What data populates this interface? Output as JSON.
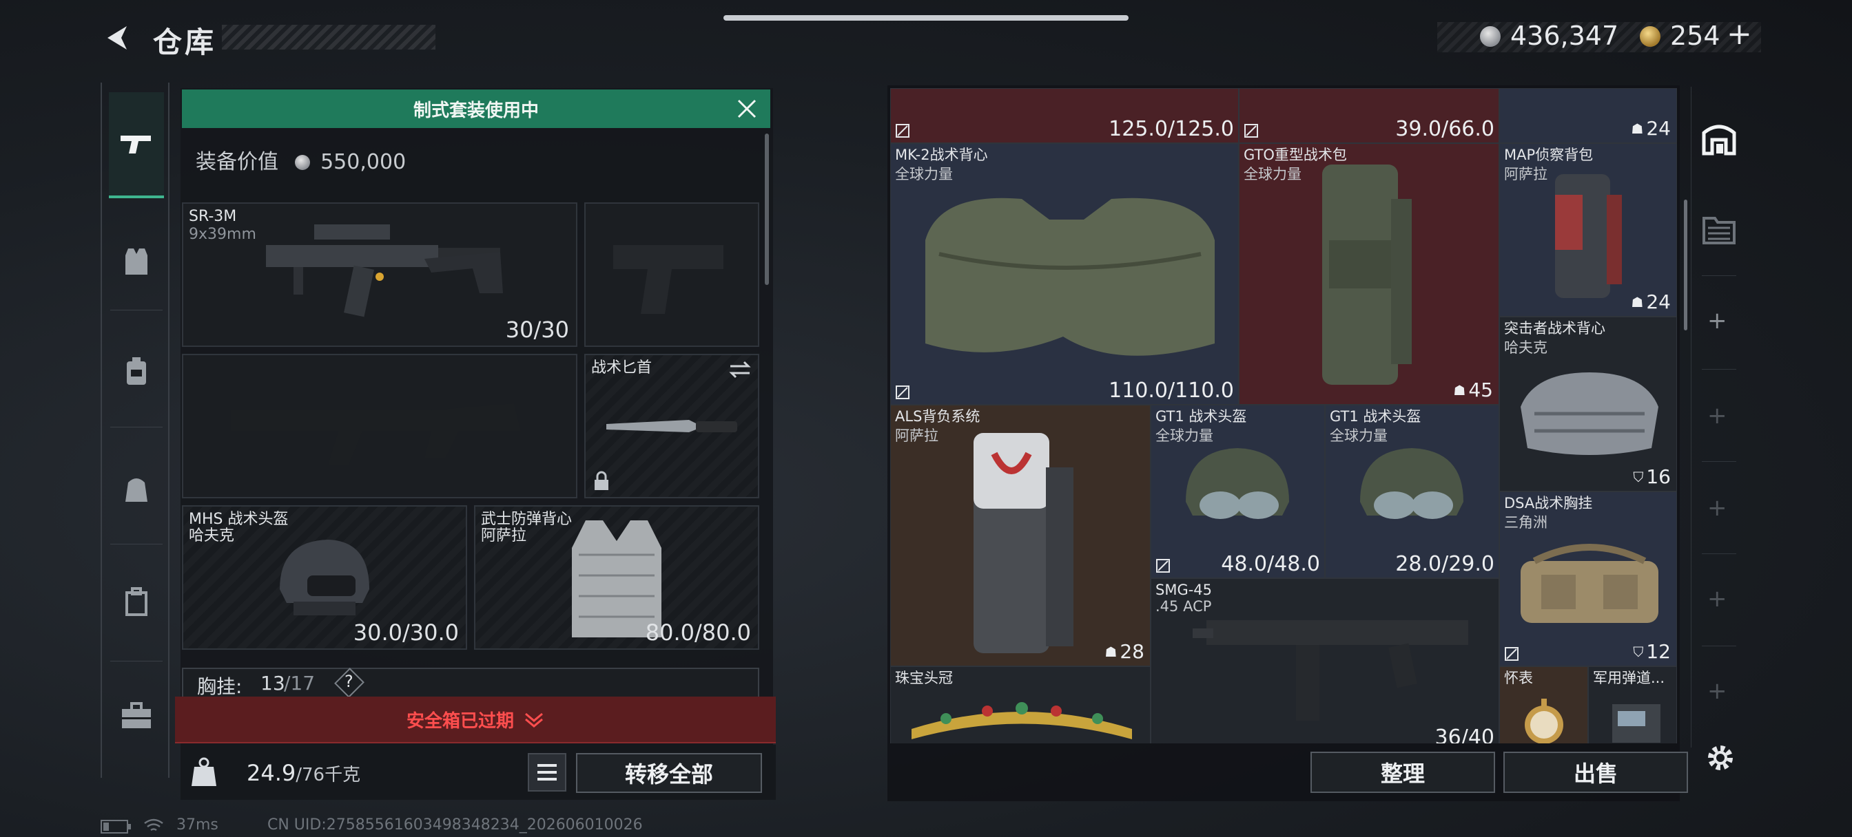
{
  "header": {
    "title": "仓库",
    "silver_amount": "436,347",
    "gold_amount": "254",
    "gold_plus": "+"
  },
  "loadout": {
    "banner": "制式套装使用中",
    "equip_value_label": "装备价值",
    "equip_value": "550,000",
    "primary": {
      "name": "SR-3M",
      "ammo": "9x39mm",
      "count": "30/30"
    },
    "melee": {
      "name": "战术匕首"
    },
    "helmet": {
      "name": "MHS 战术头盔",
      "maker": "哈夫克",
      "durability": "30.0/30.0"
    },
    "armor": {
      "name": "武士防弹背心",
      "maker": "阿萨拉",
      "durability": "80.0/80.0"
    },
    "chest_label": "胸挂:",
    "chest_used": "13",
    "chest_total": "/17",
    "help": "?",
    "safe_box": "安全箱已过期",
    "weight": "24.9",
    "weight_total": "/76千克",
    "transfer_all": "转移全部"
  },
  "inventory": {
    "top_row": [
      {
        "value": "125.0/125.0"
      },
      {
        "value": "39.0/66.0"
      },
      {
        "badge": "24"
      }
    ],
    "items": [
      {
        "name": "MK-2战术背心",
        "maker": "全球力量",
        "value": "110.0/110.0"
      },
      {
        "name": "GTO重型战术包",
        "maker": "全球力量",
        "badge": "45"
      },
      {
        "name": "MAP侦察背包",
        "maker": "阿萨拉",
        "badge": "24"
      },
      {
        "name": "突击者战术背心",
        "maker": "哈夫克",
        "badge": "16"
      },
      {
        "name": "ALS背负系统",
        "maker": "阿萨拉",
        "badge": "28"
      },
      {
        "name": "GT1 战术头盔",
        "maker": "全球力量",
        "value": "48.0/48.0"
      },
      {
        "name": "GT1 战术头盔",
        "maker": "全球力量",
        "value": "28.0/29.0"
      },
      {
        "name": "DSA战术胸挂",
        "maker": "三角洲",
        "badge": "12"
      },
      {
        "name": "SMG-45",
        "maker": ".45 ACP",
        "value": "36/40"
      },
      {
        "name": "珠宝头冠"
      },
      {
        "name": "怀表"
      },
      {
        "name": "军用弹道..."
      }
    ],
    "sort_label": "整理",
    "sell_label": "出售"
  },
  "right_rail": {
    "plus": "+"
  },
  "status": {
    "ping": "37ms",
    "uid": "CN UID:27585561603498348234_202606010026"
  },
  "colors": {
    "accent_green": "#1f7a5b",
    "alert_red": "#ff4e4e",
    "cell_blue": "#2a3142",
    "cell_red": "#4a2126",
    "cell_brown": "#3b2e26"
  }
}
